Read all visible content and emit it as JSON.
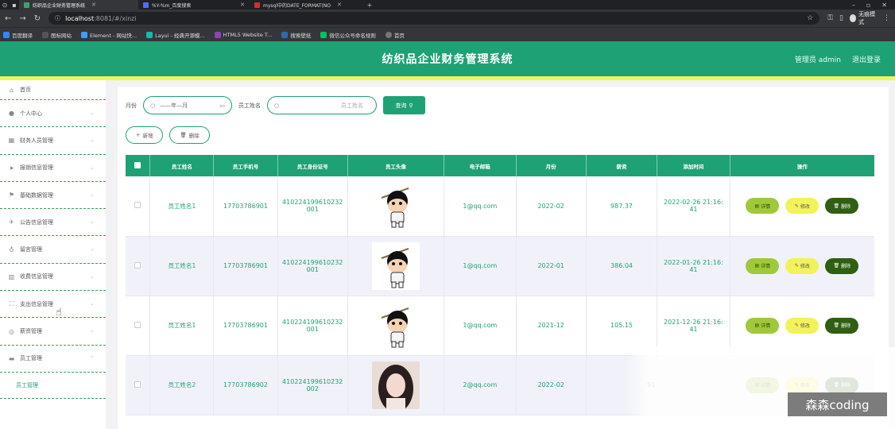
{
  "browser": {
    "tabs": [
      {
        "title": "纺织品企业财务管理系统",
        "color": "#3ea36e",
        "active": true
      },
      {
        "title": "%Y-%m_百度搜索",
        "color": "#4e6ef2",
        "active": false
      },
      {
        "title": "mysql中的DATE_FORMAT(NO",
        "color": "#c9332c",
        "active": false
      }
    ],
    "url_host": "localhost",
    "url_path": ":8081/#/xinzi",
    "incognito_label": "无痕模式",
    "bookmarks": [
      {
        "label": "百度翻译",
        "color": "#3385ff"
      },
      {
        "label": "图标网站",
        "color": "#555555"
      },
      {
        "label": "Element - 网站快...",
        "color": "#409eff"
      },
      {
        "label": "Layui - 经典开源模...",
        "color": "#16baaa"
      },
      {
        "label": "HTML5 Website T...",
        "color": "#8e44ad"
      },
      {
        "label": "搜索壁纸",
        "color": "#2b6cb0"
      },
      {
        "label": "微信公众号命名规则",
        "color": "#07c160"
      },
      {
        "label": "首页",
        "color": "#777777"
      }
    ]
  },
  "header": {
    "title": "纺织品企业财务管理系统",
    "admin": "管理员 admin",
    "logout": "退出登录"
  },
  "sidebar": {
    "home": "首页",
    "items": [
      {
        "label": "个人中心",
        "icon": "user-icon"
      },
      {
        "label": "财务人员管理",
        "icon": "grid-icon"
      },
      {
        "label": "报销信息管理",
        "icon": "send-icon"
      },
      {
        "label": "基础数据管理",
        "icon": "flag-icon"
      },
      {
        "label": "公告信息管理",
        "icon": "plane-icon"
      },
      {
        "label": "留言管理",
        "icon": "mic-icon"
      },
      {
        "label": "收费信息管理",
        "icon": "chart-icon"
      },
      {
        "label": "支出信息管理",
        "icon": "frame-icon"
      },
      {
        "label": "薪资管理",
        "icon": "coin-icon"
      },
      {
        "label": "员工管理",
        "icon": "monitor-icon"
      }
    ],
    "sub": "员工管理"
  },
  "search": {
    "month_label": "月份",
    "month_placeholder": "——年—月",
    "name_label": "员工姓名",
    "name_placeholder": "员工姓名",
    "query": "查询"
  },
  "toolbar": {
    "add": "新增",
    "delete": "删除"
  },
  "table": {
    "headers": [
      "员工姓名",
      "员工手机号",
      "员工身份证号",
      "员工头像",
      "电子邮箱",
      "月份",
      "薪资",
      "添加时间",
      "操作"
    ],
    "rows": [
      {
        "name": "员工姓名1",
        "phone": "17703786901",
        "id1": "410224199610232",
        "id2": "001",
        "avatar": "cartoon",
        "email": "1@qq.com",
        "month": "2022-02",
        "salary": "987.37",
        "t1": "2022-02-26 21:16:",
        "t2": "41"
      },
      {
        "name": "员工姓名1",
        "phone": "17703786901",
        "id1": "410224199610232",
        "id2": "001",
        "avatar": "cartoon",
        "email": "1@qq.com",
        "month": "2022-01",
        "salary": "386.04",
        "t1": "2022-01-26 21:16:",
        "t2": "41"
      },
      {
        "name": "员工姓名1",
        "phone": "17703786901",
        "id1": "410224199610232",
        "id2": "001",
        "avatar": "cartoon",
        "email": "1@qq.com",
        "month": "2021-12",
        "salary": "105.15",
        "t1": "2021-12-26 21:16:",
        "t2": "41"
      },
      {
        "name": "员工姓名2",
        "phone": "17703786902",
        "id1": "410224199610232",
        "id2": "002",
        "avatar": "photo",
        "email": "2@qq.com",
        "month": "2022-02",
        "salary": "91",
        "t1": "",
        "t2": ""
      }
    ],
    "op_detail": "详情",
    "op_edit": "修改",
    "op_delete": "删除"
  },
  "watermark": "森森coding"
}
